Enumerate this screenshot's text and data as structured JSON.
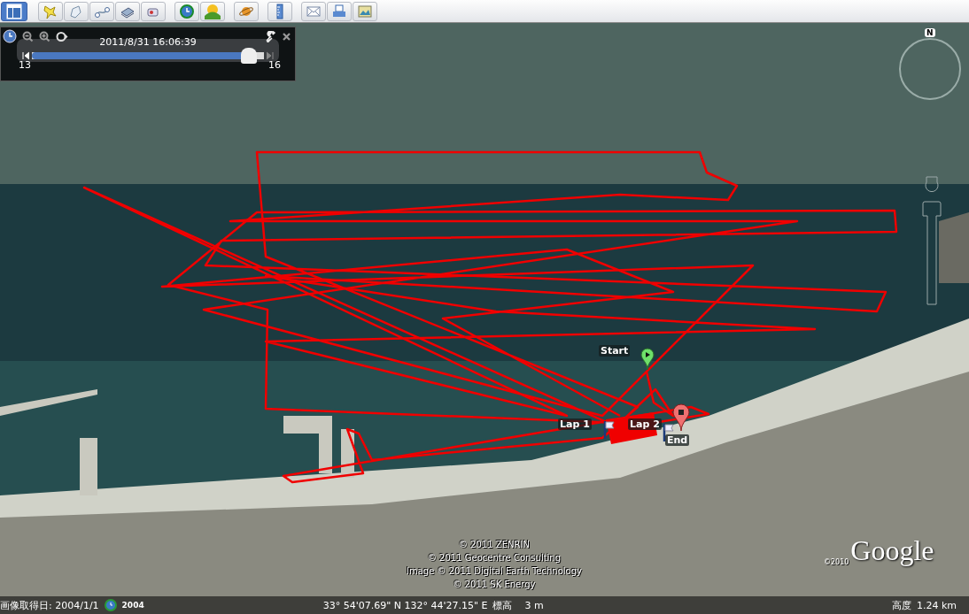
{
  "time_slider": {
    "datetime": "2011/8/31  16:06:39",
    "start_label": "13",
    "end_label": "16",
    "level": 0.96
  },
  "compass": {
    "north": "N"
  },
  "placemarks": [
    {
      "label": "Start",
      "kind": "start"
    },
    {
      "label": "Lap 1",
      "kind": "lap"
    },
    {
      "label": "Lap 2",
      "kind": "lap"
    },
    {
      "label": "End",
      "kind": "end"
    }
  ],
  "attribution": [
    "© 2011 ZENRIN",
    "© 2011 Geocentre Consulting",
    "Image © 2011 Digital Earth Technology",
    "© 2011 SK Energy"
  ],
  "logo": {
    "year": "©2010",
    "name": "Google"
  },
  "status_bar": {
    "imagery_date": "画像取得日: 2004/1/1",
    "history_year": "2004",
    "coordinates": "33° 54'07.69\" N 132° 44'27.15\" E",
    "elevation_label": "標高",
    "elevation": "3 m",
    "altitude_label": "高度",
    "altitude": "1.24 km"
  }
}
